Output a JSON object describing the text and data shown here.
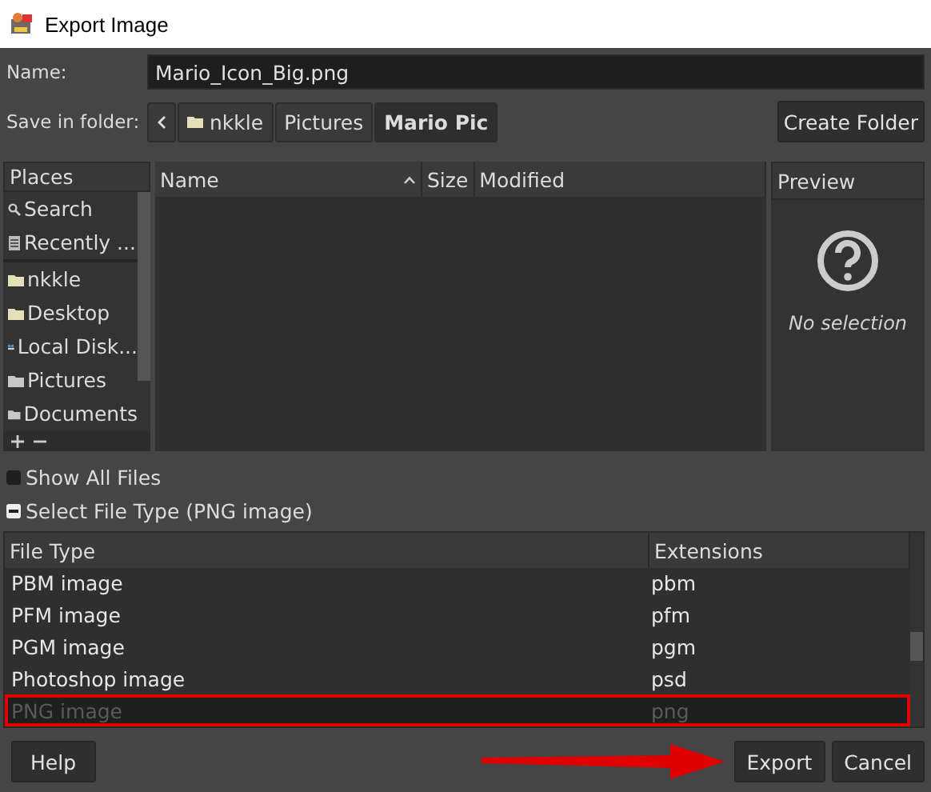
{
  "window": {
    "title": "Export Image"
  },
  "name_field": {
    "label": "Name:",
    "value": "Mario_Icon_Big.png"
  },
  "folder": {
    "label": "Save in folder:",
    "path": [
      {
        "label": "nkkle",
        "kind": "folder",
        "selected": false
      },
      {
        "label": "Pictures",
        "selected": false
      },
      {
        "label": "Mario Pic",
        "selected": true
      }
    ],
    "create_button": "Create Folder"
  },
  "places": {
    "title": "Places",
    "items": [
      {
        "label": "Search",
        "kind": "search",
        "separator_after": false
      },
      {
        "label": "Recently ...",
        "kind": "recent",
        "separator_after": true
      },
      {
        "label": "nkkle",
        "kind": "folder",
        "separator_after": false
      },
      {
        "label": "Desktop",
        "kind": "folder",
        "separator_after": false
      },
      {
        "label": "Local Disk...",
        "kind": "drive",
        "separator_after": false
      },
      {
        "label": "Pictures",
        "kind": "folder-grey",
        "separator_after": false
      },
      {
        "label": "Documents",
        "kind": "folder-grey",
        "separator_after": false
      }
    ]
  },
  "file_list": {
    "columns": [
      {
        "label": "Name",
        "sorted": true
      },
      {
        "label": "Size",
        "sorted": false
      },
      {
        "label": "Modified",
        "sorted": false
      }
    ]
  },
  "preview": {
    "title": "Preview",
    "message": "No selection"
  },
  "show_all_files": {
    "label": "Show All Files",
    "checked": false
  },
  "file_type": {
    "label": "Select File Type (PNG image)",
    "expanded": true,
    "columns": [
      "File Type",
      "Extensions"
    ],
    "rows": [
      {
        "type": "PBM image",
        "ext": "pbm",
        "selected": false,
        "highlighted": false
      },
      {
        "type": "PFM image",
        "ext": "pfm",
        "selected": false,
        "highlighted": false
      },
      {
        "type": "PGM image",
        "ext": "pgm",
        "selected": false,
        "highlighted": false
      },
      {
        "type": "Photoshop image",
        "ext": "psd",
        "selected": false,
        "highlighted": false
      },
      {
        "type": "PNG image",
        "ext": "png",
        "selected": true,
        "highlighted": true
      }
    ]
  },
  "buttons": [
    {
      "label": "Help",
      "kind": "help"
    },
    {
      "label": "Export",
      "kind": "action",
      "arrow": true
    },
    {
      "label": "Cancel",
      "kind": "action"
    }
  ]
}
